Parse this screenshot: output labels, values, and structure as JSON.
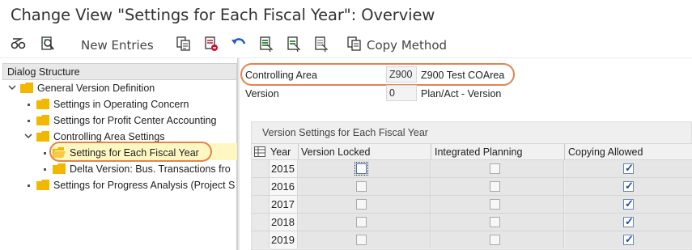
{
  "window": {
    "title": "Change View \"Settings for Each Fiscal Year\": Overview"
  },
  "toolbar": {
    "new_entries_label": "New Entries",
    "copy_method_label": "Copy Method",
    "icons": [
      "display-change-icon",
      "detail-icon",
      "new-entries",
      "copy-as-icon",
      "delete-icon",
      "undo-icon",
      "select-all-icon",
      "select-block-icon",
      "deselect-all-icon",
      "copy-method-icon"
    ]
  },
  "dialog_structure": {
    "header": "Dialog Structure",
    "items": [
      {
        "label": "General Version Definition",
        "level": 0,
        "expanded": true
      },
      {
        "label": "Settings in Operating Concern",
        "level": 1
      },
      {
        "label": "Settings for Profit Center Accounting",
        "level": 1
      },
      {
        "label": "Controlling Area Settings",
        "level": 1,
        "expanded": true
      },
      {
        "label": "Settings for Each Fiscal Year",
        "level": 2,
        "selected": true
      },
      {
        "label": "Delta Version: Bus. Transactions fro",
        "level": 2
      },
      {
        "label": "Settings for Progress Analysis (Project S",
        "level": 1
      }
    ]
  },
  "header_fields": {
    "controlling_area": {
      "label": "Controlling Area",
      "value": "Z900",
      "description": "Z900 Test COArea"
    },
    "version": {
      "label": "Version",
      "value": "0",
      "description": "Plan/Act - Version"
    }
  },
  "table": {
    "caption": "Version Settings for Each Fiscal Year",
    "columns": [
      "Year",
      "Version Locked",
      "Integrated Planning",
      "Copying Allowed"
    ],
    "rows": [
      {
        "year": "2015",
        "version_locked": false,
        "integrated_planning": false,
        "copying_allowed": true
      },
      {
        "year": "2016",
        "version_locked": false,
        "integrated_planning": false,
        "copying_allowed": true
      },
      {
        "year": "2017",
        "version_locked": false,
        "integrated_planning": false,
        "copying_allowed": true
      },
      {
        "year": "2018",
        "version_locked": false,
        "integrated_planning": false,
        "copying_allowed": true
      },
      {
        "year": "2019",
        "version_locked": false,
        "integrated_planning": false,
        "copying_allowed": true
      }
    ]
  },
  "colors": {
    "annotation_oval": "#e2844f",
    "folder": "#f2b800",
    "selected_row": "#fff7c2",
    "checkmark": "#1b4ea8"
  }
}
